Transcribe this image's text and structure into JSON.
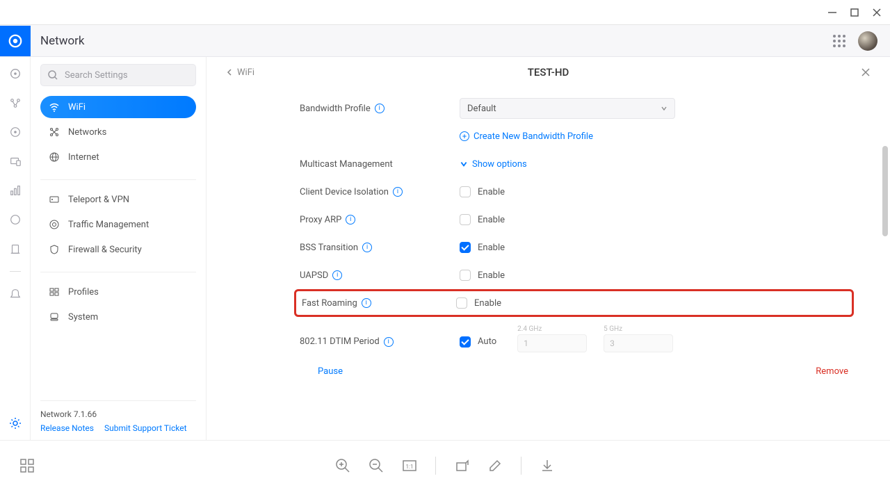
{
  "header": {
    "title": "Network"
  },
  "search": {
    "placeholder": "Search Settings"
  },
  "sidebar": {
    "items": [
      {
        "label": "WiFi"
      },
      {
        "label": "Networks"
      },
      {
        "label": "Internet"
      },
      {
        "label": "Teleport & VPN"
      },
      {
        "label": "Traffic Management"
      },
      {
        "label": "Firewall & Security"
      },
      {
        "label": "Profiles"
      },
      {
        "label": "System"
      }
    ],
    "version": "Network 7.1.66",
    "release_notes": "Release Notes",
    "support": "Submit Support Ticket"
  },
  "content": {
    "back": "WiFi",
    "title": "TEST-HD",
    "bandwidth_label": "Bandwidth Profile",
    "bandwidth_value": "Default",
    "create_bw": "Create New Bandwidth Profile",
    "multicast_label": "Multicast Management",
    "show_options": "Show options",
    "client_iso_label": "Client Device Isolation",
    "proxy_arp_label": "Proxy ARP",
    "bss_label": "BSS Transition",
    "uapsd_label": "UAPSD",
    "fast_roaming_label": "Fast Roaming",
    "dtim_label": "802.11 DTIM Period",
    "enable_text": "Enable",
    "auto_text": "Auto",
    "ghz24": "2.4 GHz",
    "ghz5": "5 GHz",
    "ghz24_val": "1",
    "ghz5_val": "3",
    "pause": "Pause",
    "remove": "Remove"
  }
}
